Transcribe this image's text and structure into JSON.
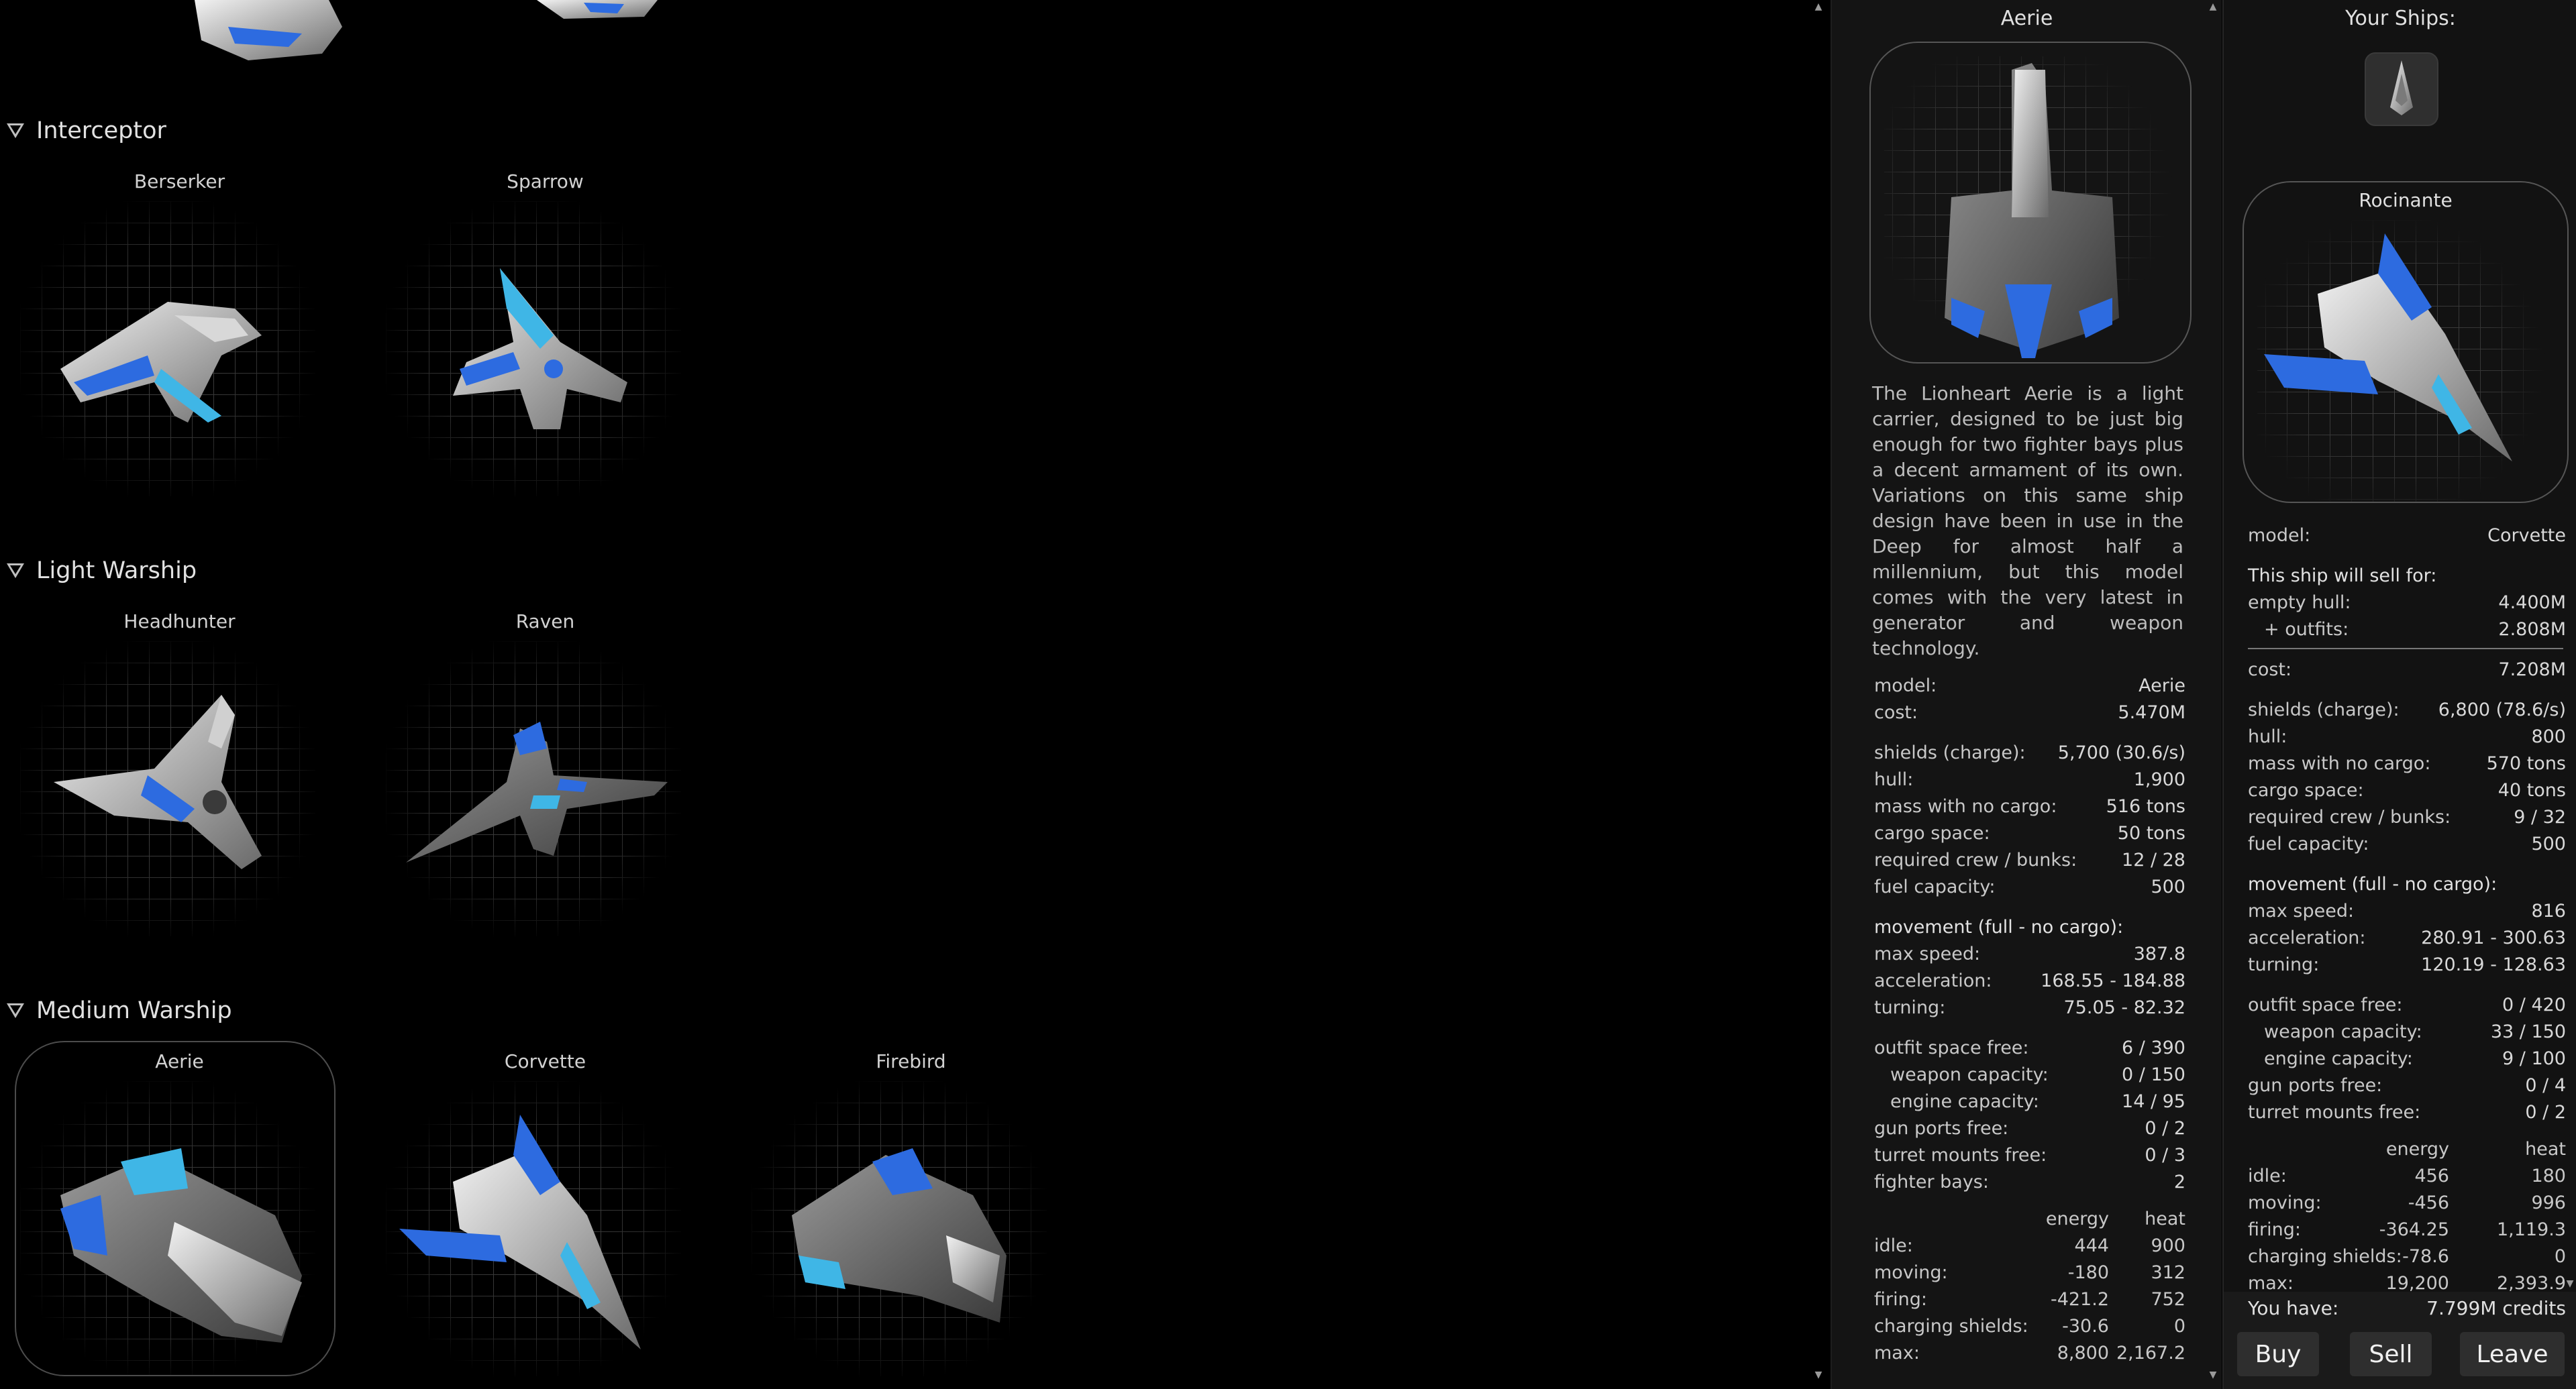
{
  "catalog": {
    "categories": [
      {
        "label": "Interceptor",
        "ships": [
          "Berserker",
          "Sparrow"
        ]
      },
      {
        "label": "Light Warship",
        "ships": [
          "Headhunter",
          "Raven"
        ]
      },
      {
        "label": "Medium Warship",
        "ships": [
          "Aerie",
          "Corvette",
          "Firebird"
        ]
      }
    ],
    "selected_ship": "Aerie"
  },
  "info": {
    "title": "Aerie",
    "description": "The Lionheart Aerie is a light carrier, designed to be just big enough for two fighter bays plus a decent armament of its own. Variations on this same ship design have been in use in the Deep for almost half a millennium, but this model comes with the very latest in generator and weapon technology.",
    "stats": [
      {
        "k": "model:",
        "v": "Aerie"
      },
      {
        "k": "cost:",
        "v": "5.470M"
      },
      {
        "k": "shields (charge):",
        "v": "5,700 (30.6/s)"
      },
      {
        "k": "hull:",
        "v": "1,900"
      },
      {
        "k": "mass with no cargo:",
        "v": "516 tons"
      },
      {
        "k": "cargo space:",
        "v": "50 tons"
      },
      {
        "k": "required crew / bunks:",
        "v": "12 / 28"
      },
      {
        "k": "fuel capacity:",
        "v": "500"
      },
      {
        "k": "movement (full - no cargo):",
        "v": ""
      },
      {
        "k": "max speed:",
        "v": "387.8"
      },
      {
        "k": "acceleration:",
        "v": "168.55 - 184.88"
      },
      {
        "k": "turning:",
        "v": "75.05 - 82.32"
      },
      {
        "k": "outfit space free:",
        "v": "6 / 390"
      },
      {
        "k": "weapon capacity:",
        "v": "0 / 150"
      },
      {
        "k": "engine capacity:",
        "v": "14 / 95"
      },
      {
        "k": "gun ports free:",
        "v": "0 / 2"
      },
      {
        "k": "turret mounts free:",
        "v": "0 / 3"
      },
      {
        "k": "fighter bays:",
        "v": "2"
      }
    ],
    "thermal_headers": [
      "energy",
      "heat"
    ],
    "thermal": [
      {
        "k": "idle:",
        "e": "444",
        "h": "900"
      },
      {
        "k": "moving:",
        "e": "-180",
        "h": "312"
      },
      {
        "k": "firing:",
        "e": "-421.2",
        "h": "752"
      },
      {
        "k": "charging shields:",
        "e": "-30.6",
        "h": "0"
      },
      {
        "k": "max:",
        "e": "8,800",
        "h": "2,167.2"
      }
    ]
  },
  "player": {
    "title": "Your Ships:",
    "ship_name": "Rocinante",
    "model_label": "model:",
    "model_value": "Corvette",
    "sell_heading": "This ship will sell for:",
    "sell_rows": [
      {
        "k": "empty hull:",
        "v": "4.400M"
      },
      {
        "k": "+ outfits:",
        "v": "2.808M"
      }
    ],
    "stats": [
      {
        "k": "cost:",
        "v": "7.208M"
      },
      {
        "k": "shields (charge):",
        "v": "6,800 (78.6/s)"
      },
      {
        "k": "hull:",
        "v": "800"
      },
      {
        "k": "mass with no cargo:",
        "v": "570 tons"
      },
      {
        "k": "cargo space:",
        "v": "40 tons"
      },
      {
        "k": "required crew / bunks:",
        "v": "9 / 32"
      },
      {
        "k": "fuel capacity:",
        "v": "500"
      },
      {
        "k": "movement (full - no cargo):",
        "v": ""
      },
      {
        "k": "max speed:",
        "v": "816"
      },
      {
        "k": "acceleration:",
        "v": "280.91 - 300.63"
      },
      {
        "k": "turning:",
        "v": "120.19 - 128.63"
      },
      {
        "k": "outfit space free:",
        "v": "0 / 420"
      },
      {
        "k": "weapon capacity:",
        "v": "33 / 150"
      },
      {
        "k": "engine capacity:",
        "v": "9 / 100"
      },
      {
        "k": "gun ports free:",
        "v": "0 / 4"
      },
      {
        "k": "turret mounts free:",
        "v": "0 / 2"
      }
    ],
    "thermal_headers": [
      "energy",
      "heat"
    ],
    "thermal": [
      {
        "k": "idle:",
        "e": "456",
        "h": "180"
      },
      {
        "k": "moving:",
        "e": "-456",
        "h": "996"
      },
      {
        "k": "firing:",
        "e": "-364.25",
        "h": "1,119.3"
      },
      {
        "k": "charging shields:",
        "e": "-78.6",
        "h": "0"
      },
      {
        "k": "max:",
        "e": "19,200",
        "h": "2,393.9"
      }
    ],
    "credits_label": "You have:",
    "credits_value": "7.799M credits",
    "buttons": {
      "buy": "Buy",
      "sell": "Sell",
      "leave": "Leave"
    }
  }
}
